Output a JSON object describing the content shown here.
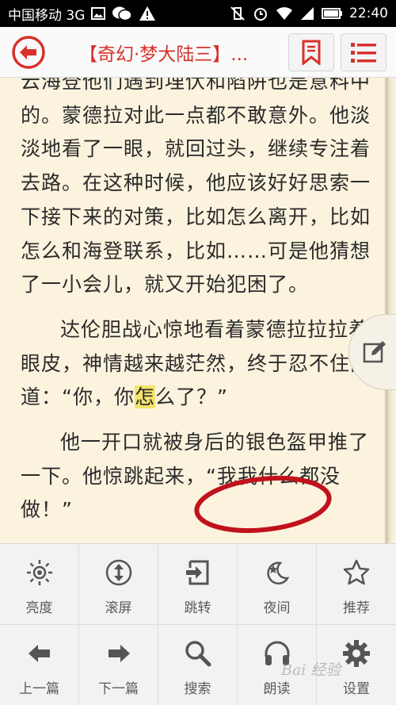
{
  "statusbar": {
    "carrier": "中国移动 3G",
    "time": "22:40"
  },
  "header": {
    "title": "【奇幻·梦大陆三】..."
  },
  "reader": {
    "paragraphs": [
      "云海登他们遇到埋伏和陷阱也是意料中的。蒙德拉对此一点都不敢意外。他淡淡地看了一眼，就回过头，继续专注着去路。在这种时候，他应该好好思索一下接下来的对策，比如怎么离开，比如怎么和海登联系，比如……可是他猜想了一小会儿，就又开始犯困了。",
      "达伦胆战心惊地看着蒙德拉",
      "他一开口就被身后的银色盔甲推了一下。他惊跳起来，“我我什么都没做！”"
    ],
    "p2_rest": "拉着眼皮，神情越来越茫然，终于忍不住问道：“你，你",
    "p2_highlight": "怎",
    "p2_end": "么了？”",
    "p2_pre": "达伦胆战心惊地看着蒙德拉拉"
  },
  "menu": {
    "items": [
      {
        "label": "亮度",
        "icon": "brightness-icon"
      },
      {
        "label": "滚屏",
        "icon": "autoscroll-icon"
      },
      {
        "label": "跳转",
        "icon": "jump-icon"
      },
      {
        "label": "夜间",
        "icon": "night-mode-icon"
      },
      {
        "label": "推荐",
        "icon": "star-icon"
      },
      {
        "label": "上一篇",
        "icon": "arrow-left-icon"
      },
      {
        "label": "下一篇",
        "icon": "arrow-right-icon"
      },
      {
        "label": "搜索",
        "icon": "search-icon"
      },
      {
        "label": "朗读",
        "icon": "headphones-icon"
      },
      {
        "label": "设置",
        "icon": "gear-icon"
      }
    ]
  },
  "watermark": "Bai 经验",
  "colors": {
    "accent": "#d8312c",
    "page_bg": "#fbf3de",
    "annotation": "#c0121b",
    "highlight": "#f3e46a"
  }
}
